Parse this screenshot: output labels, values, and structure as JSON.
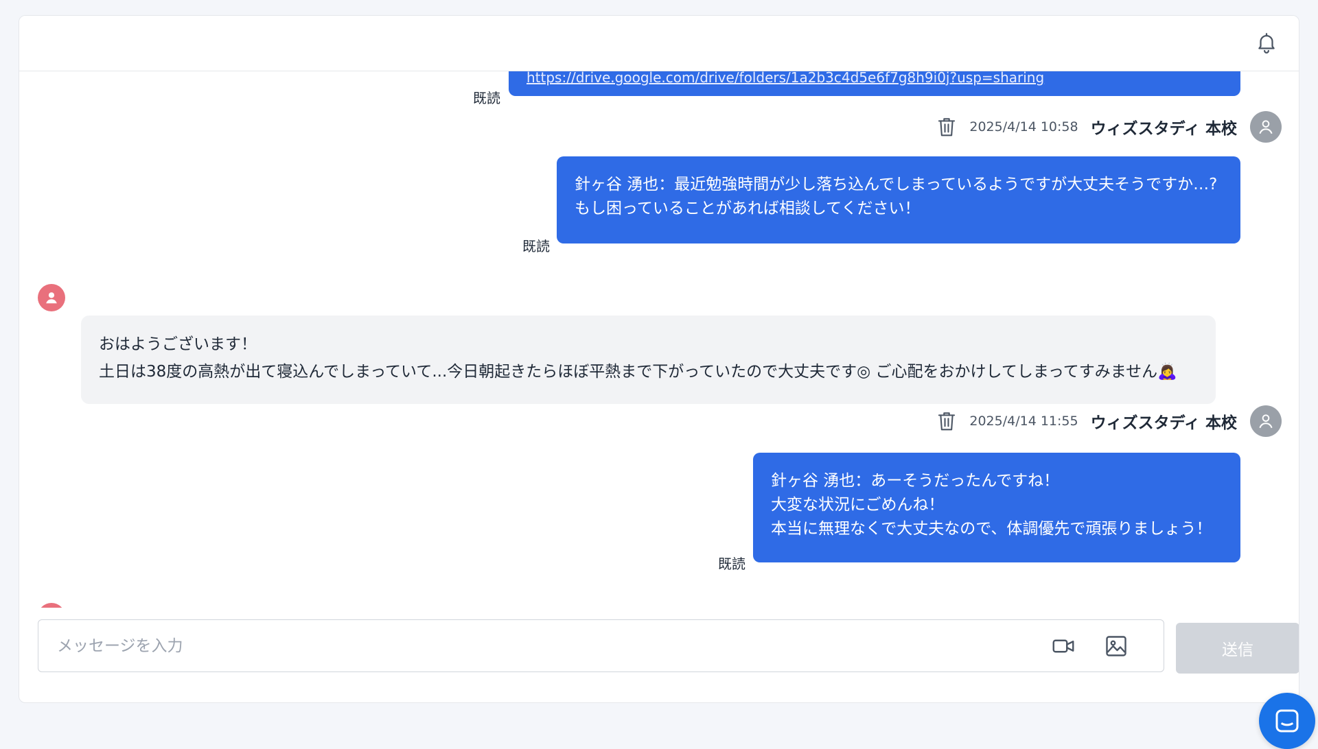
{
  "header": {
    "bell_icon": "bell-icon"
  },
  "messages": [
    {
      "direction": "outgoing",
      "read_label": "既読",
      "text": "https://drive.google.com/drive/folders/1a2b3c4d5e6f7g8h9i0j?usp=sharing"
    },
    {
      "direction": "outgoing",
      "timestamp": "2025/4/14 10:58",
      "sender": "ウィズスタディ 本校",
      "read_label": "既読",
      "text": "針ヶ谷 湧也：最近勉強時間が少し落ち込んでしまっているようですが大丈夫そうですか…?\nもし困っていることがあれば相談してください！"
    },
    {
      "direction": "incoming",
      "text": "おはようございます！\n土日は38度の高熱が出て寝込んでしまっていて...今日朝起きたらほぼ平熱まで下がっていたので大丈夫です◎ ご心配をおかけしてしまってすみません🙇‍♀️"
    },
    {
      "direction": "outgoing",
      "timestamp": "2025/4/14 11:55",
      "sender": "ウィズスタディ 本校",
      "read_label": "既読",
      "text": "針ヶ谷 湧也：あーそうだったんですね！\n大変な状況にごめんね！\n本当に無理なくで大丈夫なので、体調優先で頑張りましょう！"
    }
  ],
  "composer": {
    "placeholder": "メッセージを入力",
    "video_icon": "video-camera-icon",
    "image_icon": "image-icon",
    "send_label": "送信"
  },
  "colors": {
    "outgoing_bubble": "#2f6be6",
    "incoming_bubble": "#f2f3f5",
    "incoming_avatar": "#e9707c",
    "outgoing_avatar": "#9aa0a8",
    "send_disabled": "#d1d5db",
    "launcher": "#1a73e8"
  }
}
